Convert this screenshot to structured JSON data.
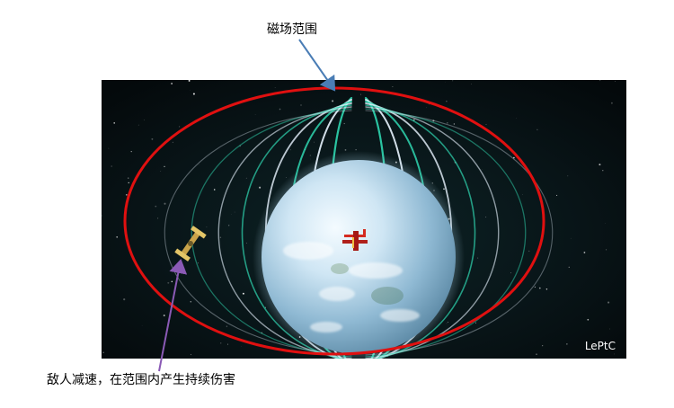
{
  "annotations": {
    "top_label": "磁场范围",
    "bottom_label": "敌人减速，在范围内产生持续伤害"
  },
  "scene": {
    "watermark": "LePtC"
  },
  "colors": {
    "circle": "#e01010",
    "arrow_top": "#4a7db5",
    "arrow_bottom": "#8a5ab5",
    "field_teal": "#2fd6b0",
    "field_white": "#e8f4ff",
    "space": "#0a1418"
  },
  "icons": [
    "satellite-icon",
    "red-biplane-icon",
    "planet-icon"
  ]
}
